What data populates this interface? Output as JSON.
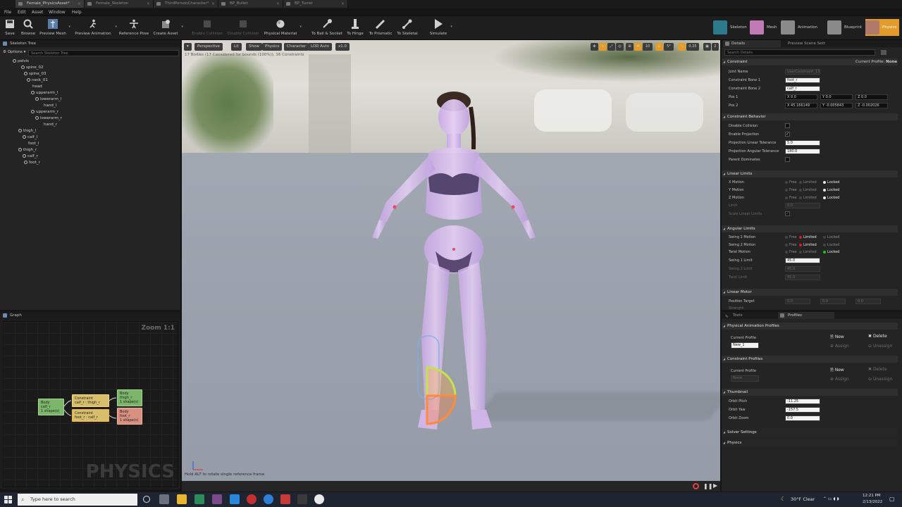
{
  "tabs": [
    "Female_PhysicsAsset*",
    "Female_Skeleton",
    "ThirdPersonCharacter*",
    "BP_Bullet",
    "BP_Turret"
  ],
  "menu": [
    "File",
    "Edit",
    "Asset",
    "Window",
    "Help"
  ],
  "toolbar": {
    "buttons": [
      "Save",
      "Browse",
      "Preview Mesh",
      "Preview Animation",
      "Reference Pose",
      "Create Asset",
      "Enable Collision",
      "Disable Collision",
      "Physical Material",
      "To Ball & Socket",
      "To Hinge",
      "To Prismatic",
      "To Skeletal",
      "Simulate"
    ],
    "modes": [
      "Skeleton",
      "Mesh",
      "Animation",
      "Blueprint",
      "Physics"
    ]
  },
  "skeleton_tree": {
    "title": "Skeleton Tree",
    "options": "Options",
    "search_placeholder": "Search Skeleton Tree",
    "bones": [
      "pelvis",
      "spine_02",
      "spine_03",
      "neck_01",
      "head",
      "upperarm_l",
      "lowerarm_l",
      "hand_l",
      "upperarm_r",
      "lowerarm_r",
      "hand_r",
      "thigh_l",
      "calf_l",
      "foot_l",
      "thigh_r",
      "calf_r",
      "foot_r"
    ]
  },
  "graph": {
    "title": "Graph",
    "zoom": "Zoom 1:1",
    "watermark": "PHYSICS",
    "nodes": {
      "body_calf": "Body\ncalf_r\n1 shape(s)",
      "con1": "Constraint\ncalf_r : thigh_r",
      "con2": "Constraint\nfoot_r : calf_r",
      "body_thigh": "Body\nthigh_r\n1 shape(s)",
      "body_foot": "Body\nfoot_r\n1 shape(s)"
    }
  },
  "viewport": {
    "buttons": [
      "Perspective",
      "Lit",
      "Show",
      "Physics",
      "Character",
      "LOD Auto",
      "x1.0"
    ],
    "info": "17 Bodies (17 Considered for bounds (100%)), 16 Constraints",
    "right_values": [
      "10",
      "5°",
      "0.25",
      "2"
    ],
    "hint": "Hold ALT to rotate single reference frame"
  },
  "details": {
    "tab1": "Details",
    "tab2": "Preview Scene Sett",
    "search_placeholder": "Search Details",
    "constraint_header": "Constraint",
    "current_profile_label": "Current Profile:",
    "current_profile_value": "None",
    "joint_name_label": "Joint Name",
    "joint_name_value": "UserConstraint_13",
    "bone1_label": "Constraint Bone 1",
    "bone1_value": "foot_r",
    "bone2_label": "Constraint Bone 2",
    "bone2_value": "calf_r",
    "pos1_label": "Pos 1",
    "pos1": {
      "x": "0.0",
      "y": "0.0",
      "z": "0.0"
    },
    "pos2_label": "Pos 2",
    "pos2": {
      "x": "45.166149",
      "y": "-0.005843",
      "z": "-0.002026"
    },
    "behavior_header": "Constraint Behavior",
    "disable_collision": "Disable Collision",
    "enable_projection": "Enable Projection",
    "proj_linear": "Projection Linear Tolerance",
    "proj_linear_value": "5.0",
    "proj_angular": "Projection Angular Tolerance",
    "proj_angular_value": "180.0",
    "parent_dominates": "Parent Dominates",
    "linear_header": "Linear Limits",
    "x_motion": "X Motion",
    "y_motion": "Y Motion",
    "z_motion": "Z Motion",
    "limit": "Limit",
    "limit_value": "0.0",
    "scale_linear": "Scale Linear Limits",
    "angular_header": "Angular Limits",
    "swing1_motion": "Swing 1 Motion",
    "swing2_motion": "Swing 2 Motion",
    "twist_motion": "Twist Motion",
    "swing1_limit": "Swing 1 Limit",
    "swing1_value": "45.0",
    "swing2_limit": "Swing 2 Limit",
    "swing2_value": "45.0",
    "twist_limit": "Twist Limit",
    "twist_value": "45.0",
    "motor_header": "Linear Motor",
    "position_target": "Position Target",
    "pt": {
      "x": "0.0",
      "y": "0.0",
      "z": "0.0"
    },
    "strength": "Strength",
    "motion_opts": {
      "free": "Free",
      "limited": "Limited",
      "locked": "Locked"
    }
  },
  "tools": {
    "tab1": "Tools",
    "tab2": "Profiles",
    "phys_profiles": "Physical Animation Profiles",
    "current_profile": "Current Profile",
    "phys_profile_value": "New_1",
    "con_profiles": "Constraint Profiles",
    "con_profile_value": "None",
    "new": "New",
    "delete": "Delete",
    "assign": "Assign",
    "unassign": "Unassign",
    "thumbnail": "Thumbnail",
    "orbit_pitch": "Orbit Pitch",
    "orbit_pitch_value": "-11.25",
    "orbit_yaw": "Orbit Yaw",
    "orbit_yaw_value": "-157.5",
    "orbit_zoom": "Orbit Zoom",
    "orbit_zoom_value": "0.0",
    "solver": "Solver Settings",
    "physics": "Physics"
  },
  "taskbar": {
    "search_placeholder": "Type here to search",
    "weather": "30°F  Clear",
    "time": "12:21 PM",
    "date": "2/13/2022"
  },
  "colors": {
    "accent": "#e39b2a",
    "panel": "#242424",
    "body_node": "#7cb66a",
    "constraint_node": "#d6be6d",
    "foot_node": "#d8907f"
  }
}
